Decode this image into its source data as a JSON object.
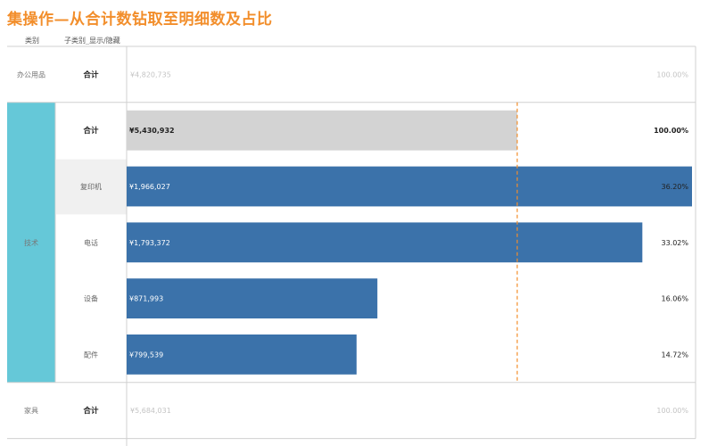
{
  "title": "集操作—从合计数钻取至明细数及占比",
  "headers": {
    "category": "类别",
    "subcategory": "子类别_显示/隐藏"
  },
  "chart_data": {
    "type": "bar",
    "orientation": "horizontal",
    "reference_line": 5430932,
    "xlim": [
      0,
      6000000
    ],
    "colors": {
      "detail_bar": "#3b72aa",
      "total_bar": "#d3d3d3",
      "selected_category": "#65c8d8",
      "reference_line": "#f28e2b",
      "hover_cell": "#f0f0f0"
    },
    "rows": [
      {
        "category": "办公用品",
        "subcategory": "合计",
        "is_total": true,
        "value": 4820735,
        "value_label": "¥4,820,735",
        "pct": 100.0,
        "pct_label": "100.00%",
        "expanded": false
      },
      {
        "category": "技术",
        "subcategory": "合计",
        "is_total": true,
        "value": 5430932,
        "value_label": "¥5,430,932",
        "pct": 100.0,
        "pct_label": "100.00%",
        "expanded": true
      },
      {
        "category": "技术",
        "subcategory": "复印机",
        "is_total": false,
        "value": 1966027,
        "value_label": "¥1,966,027",
        "pct": 36.2,
        "pct_label": "36.20%",
        "expanded": true,
        "hover": true
      },
      {
        "category": "技术",
        "subcategory": "电话",
        "is_total": false,
        "value": 1793372,
        "value_label": "¥1,793,372",
        "pct": 33.02,
        "pct_label": "33.02%",
        "expanded": true
      },
      {
        "category": "技术",
        "subcategory": "设备",
        "is_total": false,
        "value": 871993,
        "value_label": "¥871,993",
        "pct": 16.06,
        "pct_label": "16.06%",
        "expanded": true
      },
      {
        "category": "技术",
        "subcategory": "配件",
        "is_total": false,
        "value": 799539,
        "value_label": "¥799,539",
        "pct": 14.72,
        "pct_label": "14.72%",
        "expanded": true
      },
      {
        "category": "家具",
        "subcategory": "合计",
        "is_total": true,
        "value": 5684031,
        "value_label": "¥5,684,031",
        "pct": 100.0,
        "pct_label": "100.00%",
        "expanded": false
      }
    ]
  }
}
